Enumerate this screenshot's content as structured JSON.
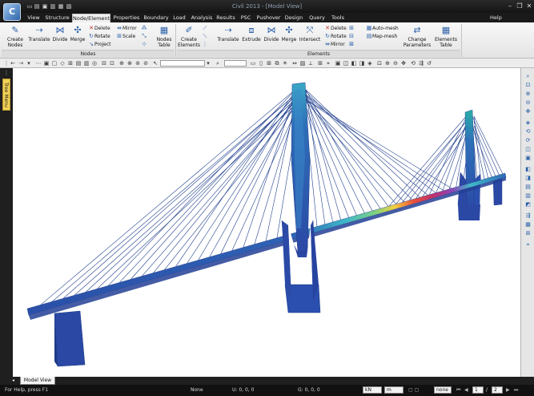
{
  "app": {
    "logo_text": "C",
    "title": "Civil 2013 - [Model View]"
  },
  "quick_access": [
    "new-icon",
    "open-icon",
    "save-icon",
    "save-as-icon",
    "print-icon",
    "print-preview-icon"
  ],
  "window_controls": [
    "minimize",
    "restore",
    "close"
  ],
  "menu": {
    "tabs": [
      "View",
      "Structure",
      "Node/Element",
      "Properties",
      "Boundary",
      "Load",
      "Analysis",
      "Results",
      "PSC",
      "Pushover",
      "Design",
      "Query",
      "Tools"
    ],
    "active_tab": "Node/Element",
    "help_label": "Help"
  },
  "ribbon": {
    "nodes_group": {
      "label": "Nodes",
      "create_nodes": "Create\nNodes",
      "translate": "Translate",
      "divide": "Divide",
      "merge": "Merge",
      "delete": "Delete",
      "rotate": "Rotate",
      "project": "Project",
      "mirror": "Mirror",
      "scale": "Scale",
      "nodes_table": "Nodes\nTable"
    },
    "elements_group": {
      "label": "Elements",
      "create_elements": "Create\nElements",
      "translate": "Translate",
      "extrude": "Extrude",
      "divide": "Divide",
      "merge": "Merge",
      "intersect": "Intersect",
      "delete": "Delete",
      "rotate": "Rotate",
      "mirror": "Mirror",
      "auto_mesh": "Auto-mesh",
      "map_mesh": "Map-mesh",
      "change_parameters": "Change\nParameters",
      "elements_table": "Elements\nTable"
    }
  },
  "left_panel": {
    "tree_tab": "Tree Menu"
  },
  "view_tabs": {
    "model_view": "Model View"
  },
  "status": {
    "help_text": "For Help, press F1",
    "selection": "None",
    "ucs_coords": "U: 0, 0, 0",
    "gcs_coords": "G: 0, 0, 0",
    "force_unit": "kN",
    "length_unit": "m",
    "extra_select": "none",
    "page_current": "1",
    "page_total": "2"
  },
  "colors": {
    "deck_low": "#2a4fa8",
    "deck_mid": "#3fb8c8",
    "deck_peak": "#e02a40",
    "cables": "#24428f",
    "pylon": "#2b48a5"
  }
}
